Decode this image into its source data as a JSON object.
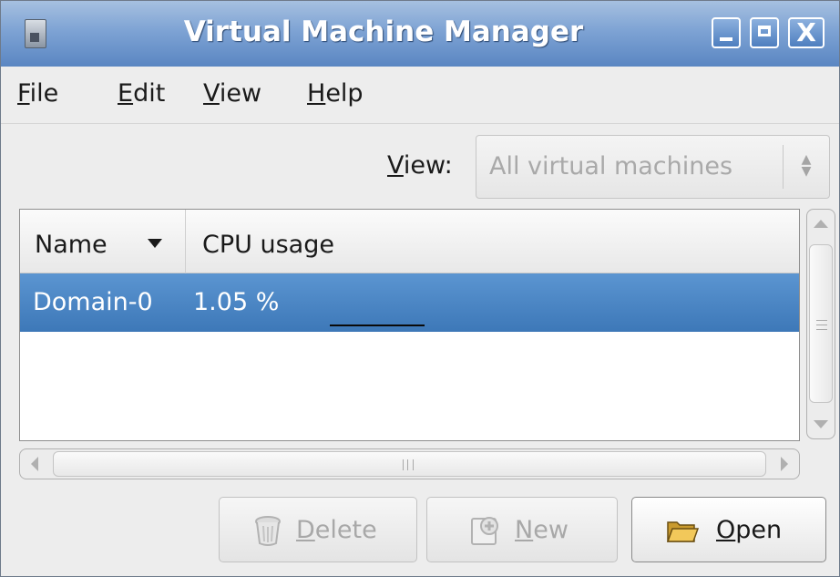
{
  "window": {
    "title": "Virtual Machine Manager",
    "controls": {
      "minimize": "minimize",
      "maximize": "maximize",
      "close": "X"
    }
  },
  "menu": [
    "File",
    "Edit",
    "View",
    "Help"
  ],
  "view_filter": {
    "label": "View:",
    "selected": "All virtual machines"
  },
  "table": {
    "columns": [
      "Name",
      "CPU usage"
    ],
    "sort_column": "Name",
    "rows": [
      {
        "name": "Domain-0",
        "cpu": "1.05 %",
        "selected": true
      }
    ]
  },
  "buttons": {
    "delete": {
      "label": "Delete",
      "enabled": false,
      "icon": "trash-icon"
    },
    "new": {
      "label": "New",
      "enabled": false,
      "icon": "new-icon"
    },
    "open": {
      "label": "Open",
      "enabled": true,
      "icon": "folder-icon"
    }
  },
  "colors": {
    "selection": "#4a86c6",
    "titlebar": "#6e97cf",
    "disabled_text": "#a8a8a8"
  }
}
